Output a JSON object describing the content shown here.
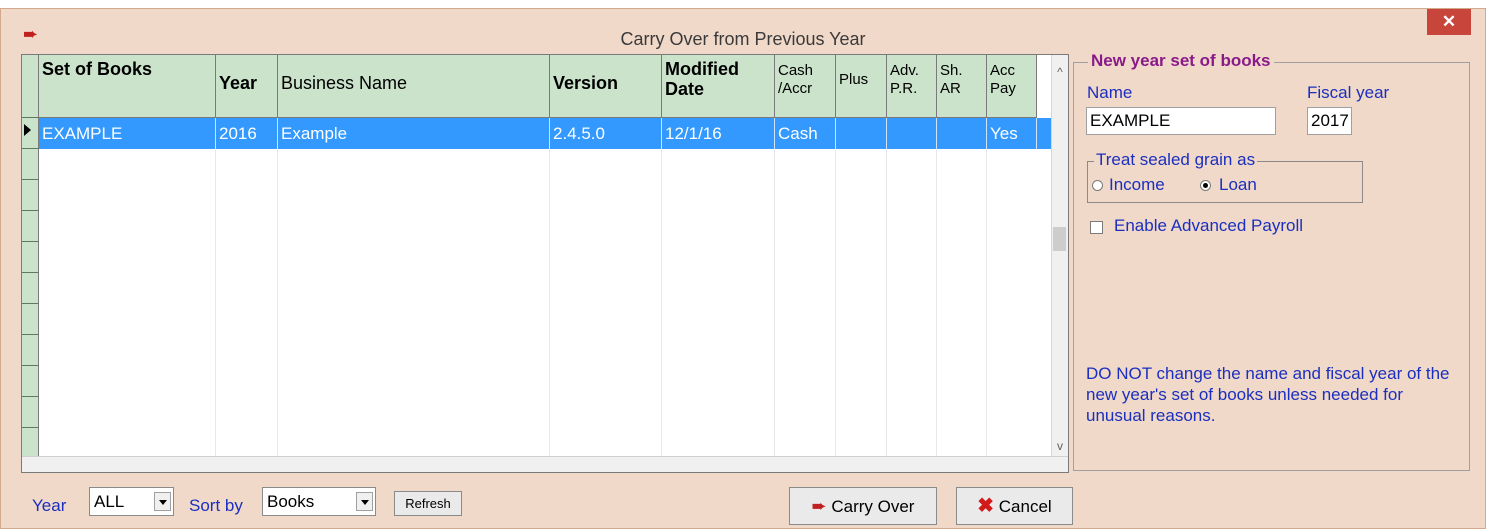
{
  "window": {
    "title": "Carry Over from Previous Year",
    "close_glyph": "✕",
    "icon": "carry-over-icon"
  },
  "grid": {
    "columns": [
      {
        "label": "Set of Books"
      },
      {
        "label": "Year"
      },
      {
        "label": "Business Name"
      },
      {
        "label": "Version"
      },
      {
        "label": "Modified Date"
      },
      {
        "label": "Cash /Accr"
      },
      {
        "label": "Plus"
      },
      {
        "label": "Adv. P.R."
      },
      {
        "label": "Sh. AR"
      },
      {
        "label": "Acc Pay"
      }
    ],
    "rows": [
      {
        "set_of_books": "EXAMPLE",
        "year": "2016",
        "business_name": "Example",
        "version": "2.4.5.0",
        "modified_date": "12/1/16",
        "cash_accr": "Cash",
        "plus": "",
        "adv_pr": "",
        "sh_ar": "",
        "acc_pay": "Yes"
      }
    ],
    "scroll_up": "^",
    "scroll_down": "v"
  },
  "new_year": {
    "legend": "New year set of books",
    "name_label": "Name",
    "fiscal_year_label": "Fiscal year",
    "name_value": "EXAMPLE",
    "fiscal_year_value": "2017",
    "sealed_grain_legend": "Treat sealed grain as",
    "income_label": "Income",
    "loan_label": "Loan",
    "selected_option": "Loan",
    "enable_payroll_label": "Enable Advanced Payroll",
    "enable_payroll_checked": false,
    "note": "DO NOT change the name and fiscal year of the new year's set of books unless needed for unusual reasons."
  },
  "bottom": {
    "year_label": "Year",
    "year_value": "ALL",
    "sort_label": "Sort by",
    "sort_value": "Books",
    "refresh_label": "Refresh",
    "carry_over_label": "Carry Over",
    "cancel_label": "Cancel"
  },
  "colors": {
    "selection": "#3399ff",
    "header_bg": "#cbe3cb",
    "window_bg": "#f1d9c9",
    "label_text": "#1a2fbf",
    "legend_text": "#8a1a8a",
    "close_bg": "#c8453c"
  }
}
